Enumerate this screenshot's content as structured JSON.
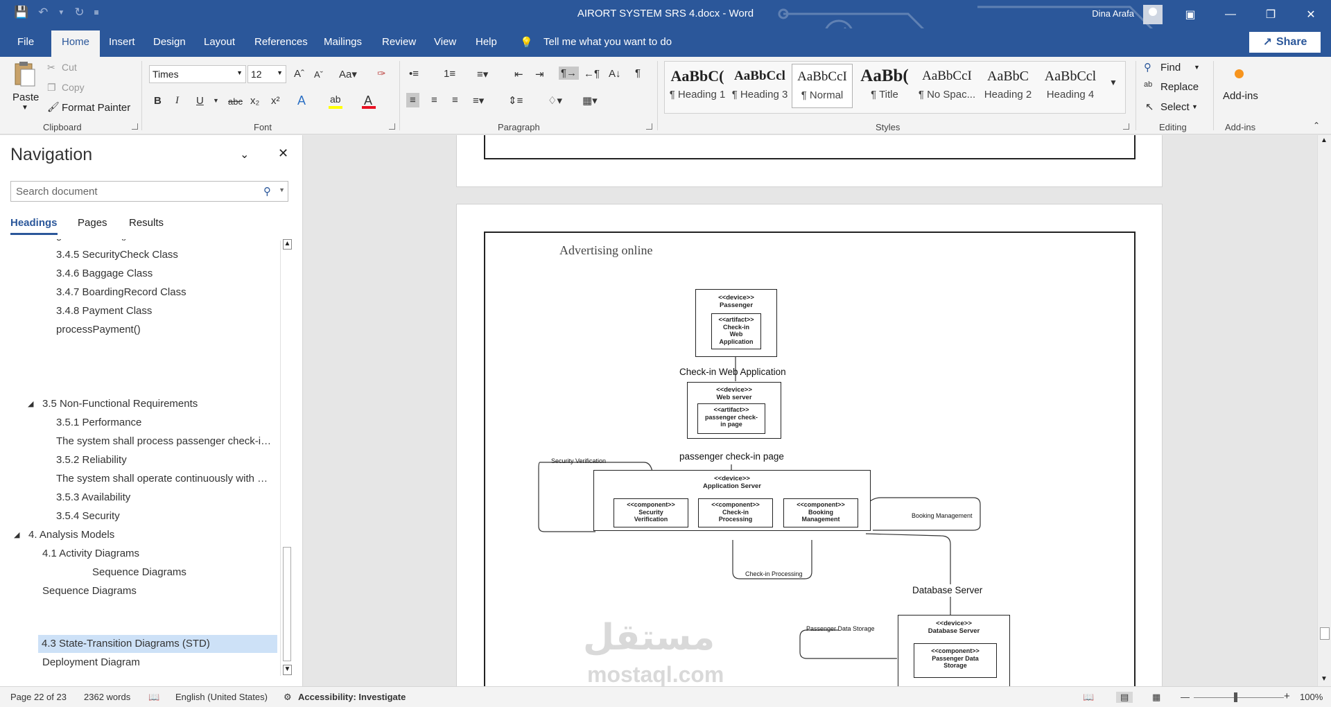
{
  "window": {
    "title": "AIRORT SYSTEM SRS 4.docx  -  Word",
    "user": "Dina Arafa",
    "qat": {
      "save": "save-icon",
      "undo": "undo-icon",
      "redo": "redo-icon",
      "customize": "customize-icon"
    },
    "controls": [
      "ribbon-display-icon",
      "minimize-icon",
      "restore-icon",
      "close-icon"
    ]
  },
  "tabs": [
    "File",
    "Home",
    "Insert",
    "Design",
    "Layout",
    "References",
    "Mailings",
    "Review",
    "View",
    "Help"
  ],
  "tell_me": "Tell me what you want to do",
  "share": "Share",
  "clipboard": {
    "paste": "Paste",
    "cut": "Cut",
    "copy": "Copy",
    "format_painter": "Format Painter",
    "label": "Clipboard"
  },
  "font": {
    "name": "Times",
    "size": "12",
    "label": "Font",
    "colors": {
      "highlight": "#ffff00",
      "font_color": "#e81123"
    }
  },
  "paragraph": {
    "label": "Paragraph"
  },
  "styles": {
    "label": "Styles",
    "items": [
      {
        "sample": "AaBbC(",
        "name": "¶ Heading 1"
      },
      {
        "sample": "AaBbCcl",
        "name": "¶ Heading 3"
      },
      {
        "sample": "AaBbCcI",
        "name": "¶ Normal"
      },
      {
        "sample": "AaBb(",
        "name": "¶ Title"
      },
      {
        "sample": "AaBbCcI",
        "name": "¶ No Spac..."
      },
      {
        "sample": "AaBbC",
        "name": "Heading 2"
      },
      {
        "sample": "AaBbCcl",
        "name": "Heading 4"
      }
    ]
  },
  "editing": {
    "find": "Find",
    "replace": "Replace",
    "select": "Select",
    "label": "Editing"
  },
  "addins": {
    "button": "Add-ins",
    "label": "Add-ins"
  },
  "navigation": {
    "title": "Navigation",
    "search_placeholder": "Search document",
    "tabs": [
      "Headings",
      "Pages",
      "Results"
    ],
    "items": [
      "generateFees()",
      "3.4.5 SecurityCheck Class",
      "3.4.6 Baggage Class",
      "3.4.7 BoardingRecord Class",
      "3.4.8 Payment Class",
      "processPayment()",
      "3.5 Non-Functional Requirements",
      "3.5.1 Performance",
      "The system shall process passenger check-in, s...",
      "3.5.2 Reliability",
      "The system shall operate continuously with mi...",
      "3.5.3 Availability",
      "3.5.4 Security",
      "4. Analysis Models",
      "4.1 Activity Diagrams",
      "Sequence Diagrams",
      "Sequence Diagrams",
      "4.3 State-Transition Diagrams (STD)",
      "Deployment Diagram"
    ]
  },
  "document": {
    "heading": "Advertising online",
    "diagram": {
      "passenger_device": "<<device>>\nPassenger",
      "checkin_artifact": "<<artifact>>\nCheck-in\nWeb\nApplication",
      "label_checkin_app": "Check-in  Web Application",
      "webserver_device": "<<device>>\nWeb server",
      "page_artifact": "<<artifact>>\npassenger check-\nin page",
      "label_checkin_page": "passenger check-in page",
      "appserver_device": "<<device>>\nApplication Server",
      "comp_security": "<<component>>\nSecurity\nVerification",
      "comp_checkin": "<<component>>\nCheck-in\nProcessing",
      "comp_booking": "<<component>>\nBooking\nManagement",
      "link_security": "Security Verification",
      "link_booking": "Booking Management",
      "link_checkin": "Check-in Processing",
      "label_db": "Database Server",
      "db_device": "<<device>>\nDatabase Server",
      "comp_storage": "<<component>>\nPassenger Data\nStorage",
      "link_storage": "Passenger Data Storage"
    },
    "watermark": {
      "arabic": "مستقل",
      "latin": "mostaql.com"
    }
  },
  "status": {
    "page": "Page 22 of 23",
    "words": "2362 words",
    "language": "English (United States)",
    "accessibility": "Accessibility: Investigate",
    "zoom": "100%"
  }
}
